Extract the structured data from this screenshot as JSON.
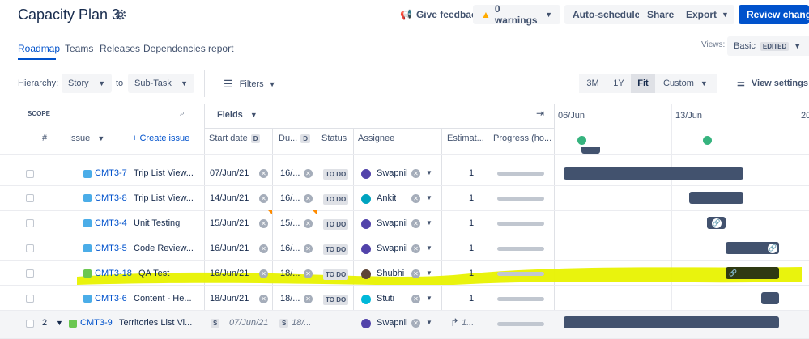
{
  "header": {
    "title": "Capacity Plan 3",
    "give_feedback": "Give feedback",
    "warnings": "0 warnings",
    "auto_schedule": "Auto-schedule",
    "share": "Share",
    "export": "Export",
    "review_changes": "Review changes"
  },
  "tabs": [
    "Roadmap",
    "Teams",
    "Releases",
    "Dependencies report"
  ],
  "views": {
    "label": "Views:",
    "value": "Basic",
    "badge": "EDITED"
  },
  "toolbar": {
    "hierarchy_label": "Hierarchy:",
    "hierarchy_from": "Story",
    "to_label": "to",
    "hierarchy_to": "Sub-Task",
    "filters": "Filters",
    "zoom": [
      "3M",
      "1Y",
      "Fit"
    ],
    "custom": "Custom",
    "view_settings": "View settings"
  },
  "table_header": {
    "scope": "SCOPE",
    "fields": "Fields",
    "hash": "#",
    "issue": "Issue",
    "create_issue": "+ Create issue",
    "start_date": "Start date",
    "due": "Du...",
    "d_badge": "D",
    "status": "Status",
    "assignee": "Assignee",
    "estimate": "Estimat...",
    "progress": "Progress (ho...",
    "timeline_dates": [
      "06/Jun",
      "13/Jun",
      "20"
    ]
  },
  "rows": [
    {
      "key": "CMT3-7",
      "summary": "Trip List View...",
      "start": "07/Jun/21",
      "due": "16/...",
      "status": "TO DO",
      "assignee": "Swapnil",
      "estimate": "1"
    },
    {
      "key": "CMT3-8",
      "summary": "Trip List View...",
      "start": "14/Jun/21",
      "due": "16/...",
      "status": "TO DO",
      "assignee": "Ankit",
      "estimate": "1"
    },
    {
      "key": "CMT3-4",
      "summary": "Unit Testing",
      "start": "15/Jun/21",
      "due": "15/...",
      "status": "TO DO",
      "assignee": "Swapnil",
      "estimate": "1"
    },
    {
      "key": "CMT3-5",
      "summary": "Code Review...",
      "start": "16/Jun/21",
      "due": "16/...",
      "status": "TO DO",
      "assignee": "Swapnil",
      "estimate": "1"
    },
    {
      "key": "CMT3-18",
      "summary": "QA Test",
      "start": "16/Jun/21",
      "due": "18/...",
      "status": "TO DO",
      "assignee": "Shubhi",
      "estimate": "1"
    },
    {
      "key": "CMT3-6",
      "summary": "Content - He...",
      "start": "18/Jun/21",
      "due": "18/...",
      "status": "TO DO",
      "assignee": "Stuti",
      "estimate": "1"
    }
  ],
  "parent_row": {
    "number": "2",
    "key": "CMT3-9",
    "summary": "Territories List Vi...",
    "start": "07/Jun/21",
    "due": "18/...",
    "s_badge": "S",
    "assignee": "Swapnil",
    "estimate": "1..."
  },
  "colors": {
    "primary": "#0052cc",
    "bar": "#42526e",
    "highlight": "#e8f200",
    "milestone": "#36b37e"
  }
}
